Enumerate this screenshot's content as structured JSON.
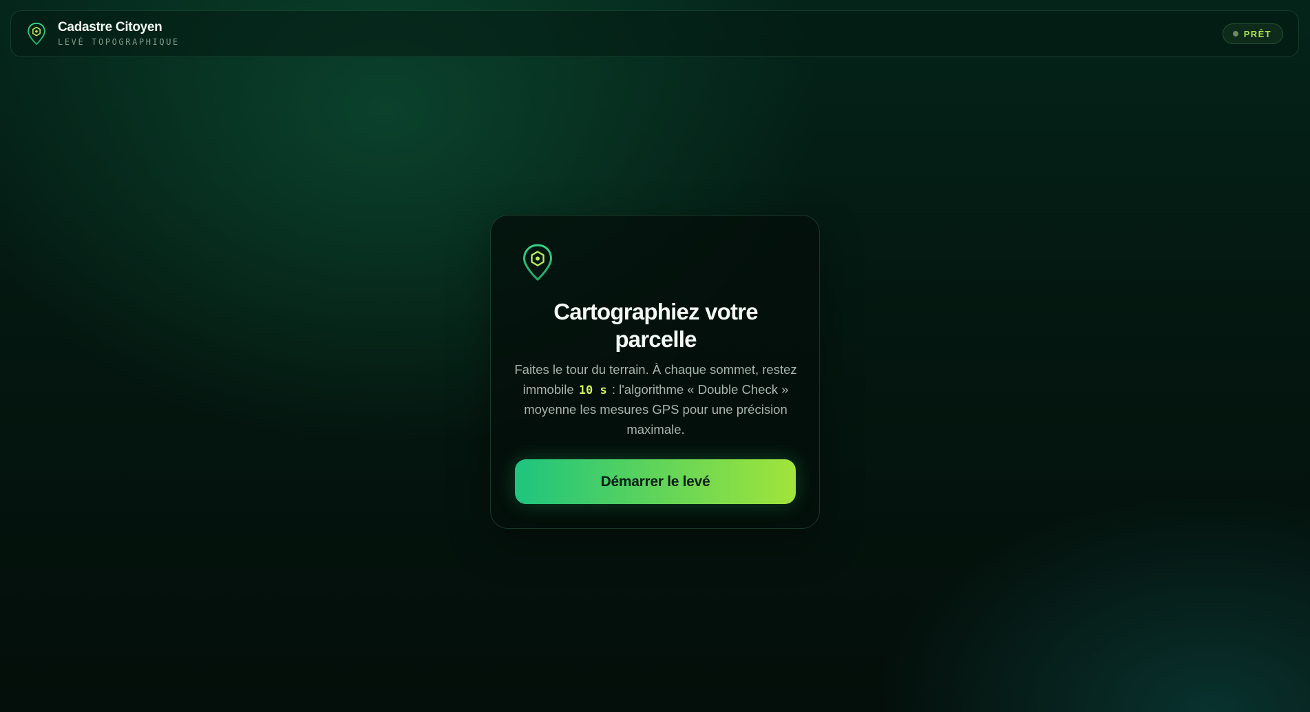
{
  "header": {
    "brand_name": "Cadastre Citoyen",
    "brand_subtitle": "LEVÉ TOPOGRAPHIQUE",
    "brand_icon": "map-pin-hexagon-icon",
    "status_label": "PRÊT"
  },
  "card": {
    "icon": "map-pin-hexagon-icon",
    "title": "Cartographiez votre parcelle",
    "desc_part1": "Faites le tour du terrain. À chaque sommet, restez immobile",
    "desc_highlight": "10 s",
    "desc_part2": ": l'algorithme « Double Check » moyenne les mesures GPS pour une précision maximale.",
    "start_button_label": "Démarrer le levé"
  },
  "colors": {
    "accent_green": "#1ec47f",
    "accent_lime": "#a2e43b",
    "highlight": "#d3f25c",
    "status_text": "#a9e24a"
  }
}
